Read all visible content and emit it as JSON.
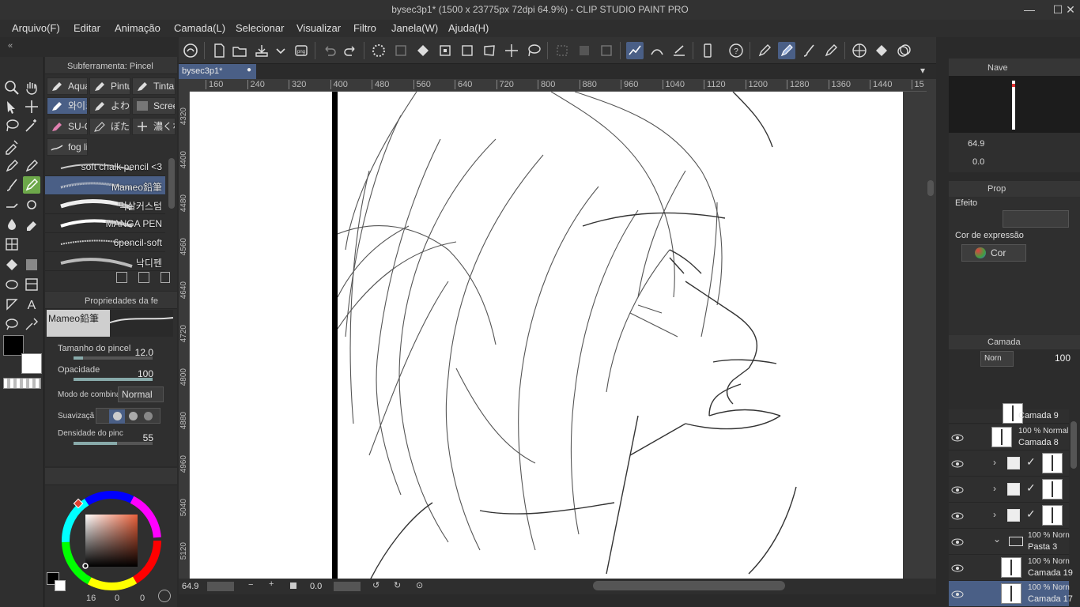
{
  "window": {
    "title": "bysec3p1* (1500 x 23775px 72dpi 64.9%) - CLIP STUDIO PAINT PRO",
    "minimize": "—",
    "maximize": "☐",
    "close": "✕"
  },
  "menu": [
    "Arquivo(F)",
    "Editar",
    "Animação",
    "Camada(L)",
    "Selecionar",
    "Visualizar",
    "Filtro",
    "Janela(W)",
    "Ajuda(H)"
  ],
  "subtool": {
    "header": "Subferramenta: Pincel",
    "groups": [
      {
        "label": "Aqua",
        "icon": "brush-icon"
      },
      {
        "label": "Pintu",
        "icon": "brush-icon"
      },
      {
        "label": "Tinta",
        "icon": "brush-icon"
      },
      {
        "label": "와이크",
        "icon": "brush-icon",
        "selected": true
      },
      {
        "label": "よわ",
        "icon": "brush-icon"
      },
      {
        "label": "Scree",
        "icon": "screentone-icon"
      },
      {
        "label": "SU-C",
        "icon": "brush-icon"
      },
      {
        "label": "ぼた",
        "icon": "brush-icon"
      },
      {
        "label": "濃くな",
        "icon": "sparkle-icon"
      },
      {
        "label": "fog lin",
        "icon": "fog-icon"
      }
    ],
    "brushes": [
      {
        "label": "soft chalk pencil <3"
      },
      {
        "label": "Mameo鉛筆",
        "selected": true
      },
      {
        "label": "먹살커스텀"
      },
      {
        "label": "MANGA PEN"
      },
      {
        "label": "6pencil-soft"
      },
      {
        "label": "낙디펜"
      }
    ]
  },
  "toolprop": {
    "header": "Propriedades da fe",
    "preview_name": "Mameo鉛筆",
    "brush_size_label": "Tamanho do pincel",
    "brush_size": "12.0",
    "opacity_label": "Opacidade",
    "opacity": "100",
    "blend_label": "Modo de combinaç",
    "blend_value": "Normal",
    "smoothing_label": "Suavizaçã",
    "density_label": "Densidade do pinc",
    "density": "55",
    "brush_size_fraction": 0.12,
    "opacity_fraction": 1.0,
    "density_fraction": 0.55
  },
  "color": {
    "main": "#000000",
    "sub": "#ffffff",
    "footer_val1": "16",
    "footer_val2": "0",
    "footer_val3": "0"
  },
  "doc_tab": "bysec3p1*",
  "ruler": {
    "h_ticks": [
      "160",
      "240",
      "320",
      "400",
      "480",
      "560",
      "640",
      "720",
      "800",
      "880",
      "960",
      "1040",
      "1120",
      "1200",
      "1280",
      "1360",
      "1440",
      "15"
    ],
    "v_ticks": [
      "4320",
      "4400",
      "4480",
      "4560",
      "4640",
      "4720",
      "4800",
      "4880",
      "4960",
      "5040",
      "5120"
    ]
  },
  "status": {
    "zoom": "64.9",
    "rotation": "0.0"
  },
  "navigator": {
    "header": "Nave",
    "zoom": "64.9",
    "rotation": "0.0"
  },
  "propriedade": {
    "header": "Prop",
    "efeito_label": "Efeito",
    "expr_label": "Cor de expressão",
    "expr_value": "Cor"
  },
  "layers": {
    "header": "Camada",
    "blend": "Norn",
    "opacity": "100",
    "rows": [
      {
        "mode": "",
        "name": "Camada 9"
      },
      {
        "mode": "100 % Normal",
        "name": "Camada 8"
      },
      {
        "mode": "",
        "name": ""
      },
      {
        "mode": "",
        "name": ""
      },
      {
        "mode": "",
        "name": ""
      },
      {
        "mode": "100 % Norn",
        "name": "Pasta 3"
      },
      {
        "mode": "100 % Norn",
        "name": "Camada 19"
      },
      {
        "mode": "100 % Norn",
        "name": "Camada 17",
        "selected": true
      }
    ]
  },
  "colors": {
    "accent": "#4a5f86",
    "active_tool": "#6da84a",
    "panel": "#2f2f2f"
  }
}
